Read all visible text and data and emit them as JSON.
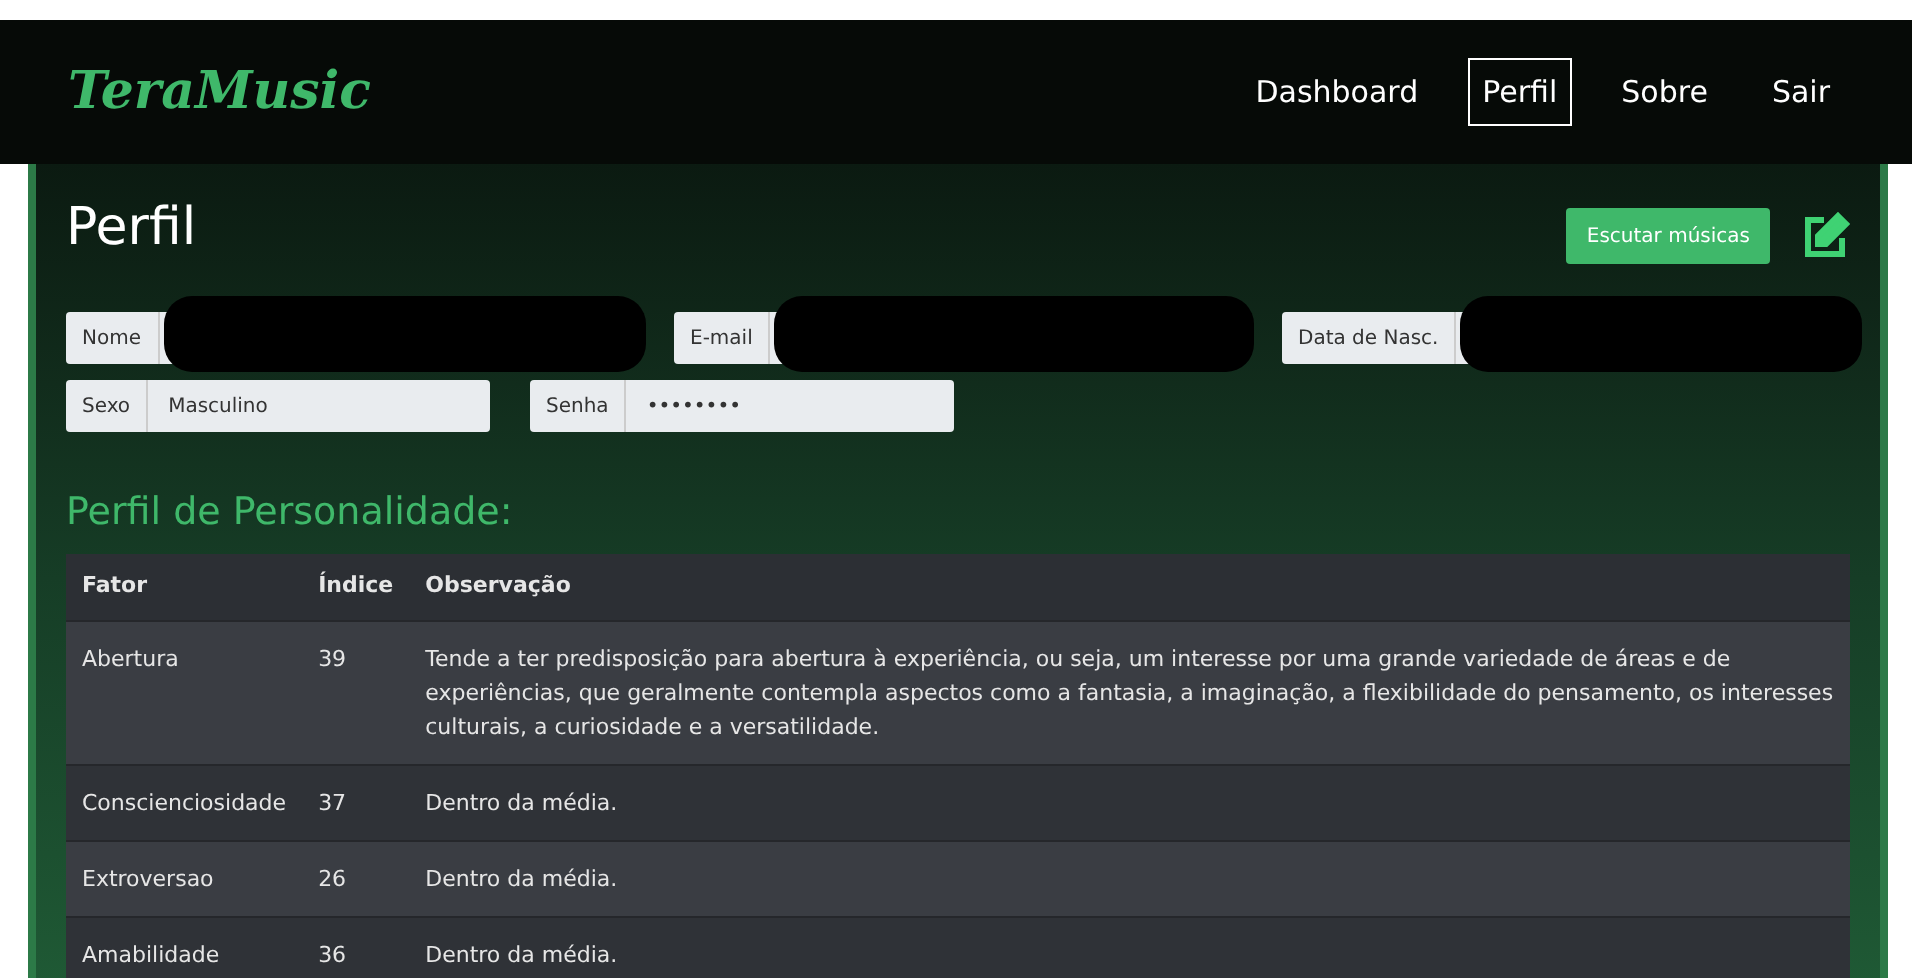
{
  "brand": "TeraMusic",
  "nav": [
    {
      "label": "Dashboard",
      "selected": false
    },
    {
      "label": "Perfil",
      "selected": true
    },
    {
      "label": "Sobre",
      "selected": false
    },
    {
      "label": "Sair",
      "selected": false
    }
  ],
  "page_title": "Perfil",
  "listen_button": "Escutar músicas",
  "fields": [
    [
      {
        "label": "Nome",
        "redacted": true
      },
      {
        "label": "E-mail",
        "redacted": true
      },
      {
        "label": "Data de Nasc.",
        "redacted": true
      }
    ],
    [
      {
        "label": "Sexo",
        "value": "Masculino",
        "redacted": false
      },
      {
        "label": "Senha",
        "value": "••••••••",
        "redacted": false
      }
    ]
  ],
  "section_title": "Perfil de Personalidade:",
  "table": {
    "columns": [
      "Fator",
      "Índice",
      "Observação"
    ],
    "rows": [
      [
        "Abertura",
        "39",
        "Tende a ter predisposição para abertura à experiência, ou seja, um interesse por uma grande variedade de áreas e de experiências, que geralmente contempla aspectos como a fantasia, a imaginação, a flexibilidade do pensamento, os interesses culturais, a curiosidade e a versatilidade."
      ],
      [
        "Conscienciosidade",
        "37",
        "Dentro da média."
      ],
      [
        "Extroversao",
        "26",
        "Dentro da média."
      ],
      [
        "Amabilidade",
        "36",
        "Dentro da média."
      ]
    ]
  }
}
